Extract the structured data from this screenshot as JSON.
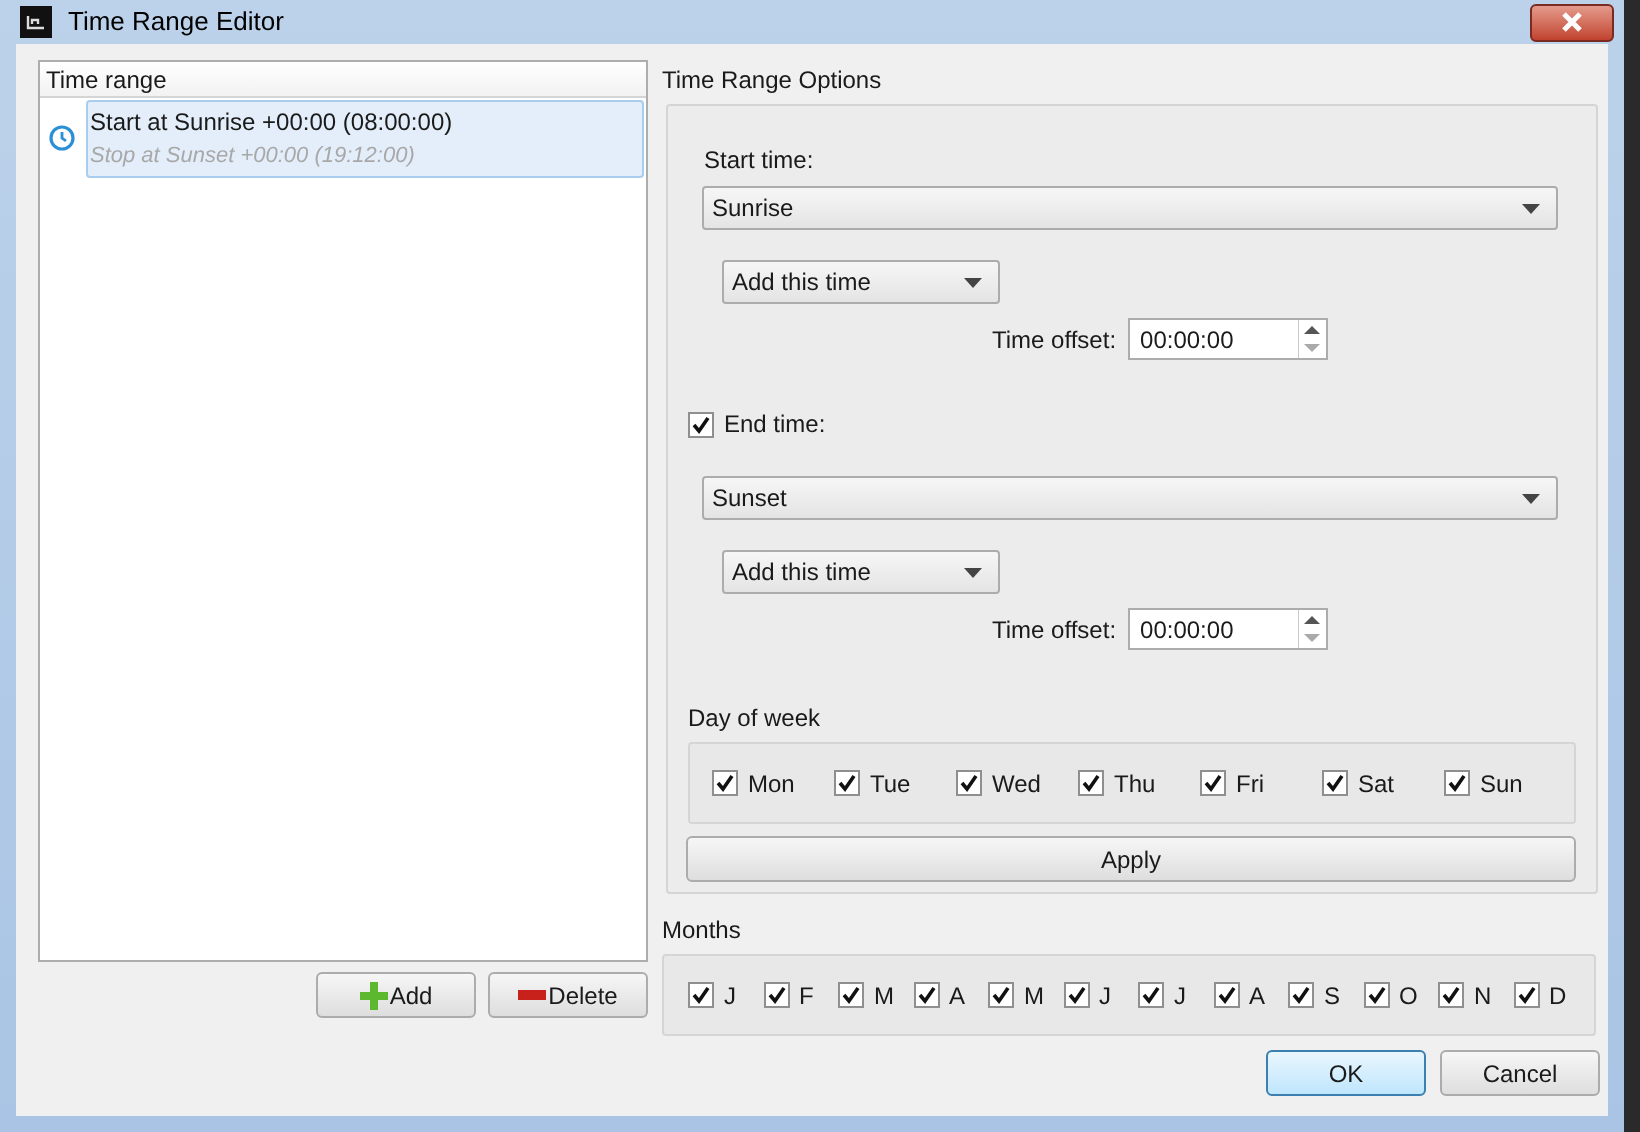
{
  "window": {
    "title": "Time Range Editor"
  },
  "time_range_list": {
    "header": "Time range",
    "items": [
      {
        "primary": "Start at Sunrise +00:00 (08:00:00)",
        "secondary": "Stop at Sunset +00:00 (19:12:00)",
        "selected": true
      }
    ]
  },
  "list_buttons": [
    {
      "kind": "add",
      "label": "Add"
    },
    {
      "kind": "delete",
      "label": "Delete"
    }
  ],
  "options": {
    "title": "Time Range Options",
    "start": {
      "label": "Start time:",
      "event": "Sunrise",
      "mode": "Add this time",
      "offset_label": "Time offset:",
      "offset": "00:00:00"
    },
    "end": {
      "label": "End time:",
      "checked": true,
      "event": "Sunset",
      "mode": "Add this time",
      "offset_label": "Time offset:",
      "offset": "00:00:00"
    },
    "day_of_week": {
      "title": "Day of week",
      "days": [
        {
          "label": "Mon",
          "checked": true
        },
        {
          "label": "Tue",
          "checked": true
        },
        {
          "label": "Wed",
          "checked": true
        },
        {
          "label": "Thu",
          "checked": true
        },
        {
          "label": "Fri",
          "checked": true
        },
        {
          "label": "Sat",
          "checked": true
        },
        {
          "label": "Sun",
          "checked": true
        }
      ]
    },
    "apply": "Apply"
  },
  "months": {
    "title": "Months",
    "items": [
      {
        "label": "J",
        "checked": true
      },
      {
        "label": "F",
        "checked": true
      },
      {
        "label": "M",
        "checked": true
      },
      {
        "label": "A",
        "checked": true
      },
      {
        "label": "M",
        "checked": true
      },
      {
        "label": "J",
        "checked": true
      },
      {
        "label": "J",
        "checked": true
      },
      {
        "label": "A",
        "checked": true
      },
      {
        "label": "S",
        "checked": true
      },
      {
        "label": "O",
        "checked": true
      },
      {
        "label": "N",
        "checked": true
      },
      {
        "label": "D",
        "checked": true
      }
    ]
  },
  "dialog_buttons": [
    {
      "label": "OK",
      "default": true
    },
    {
      "label": "Cancel",
      "default": false
    }
  ]
}
